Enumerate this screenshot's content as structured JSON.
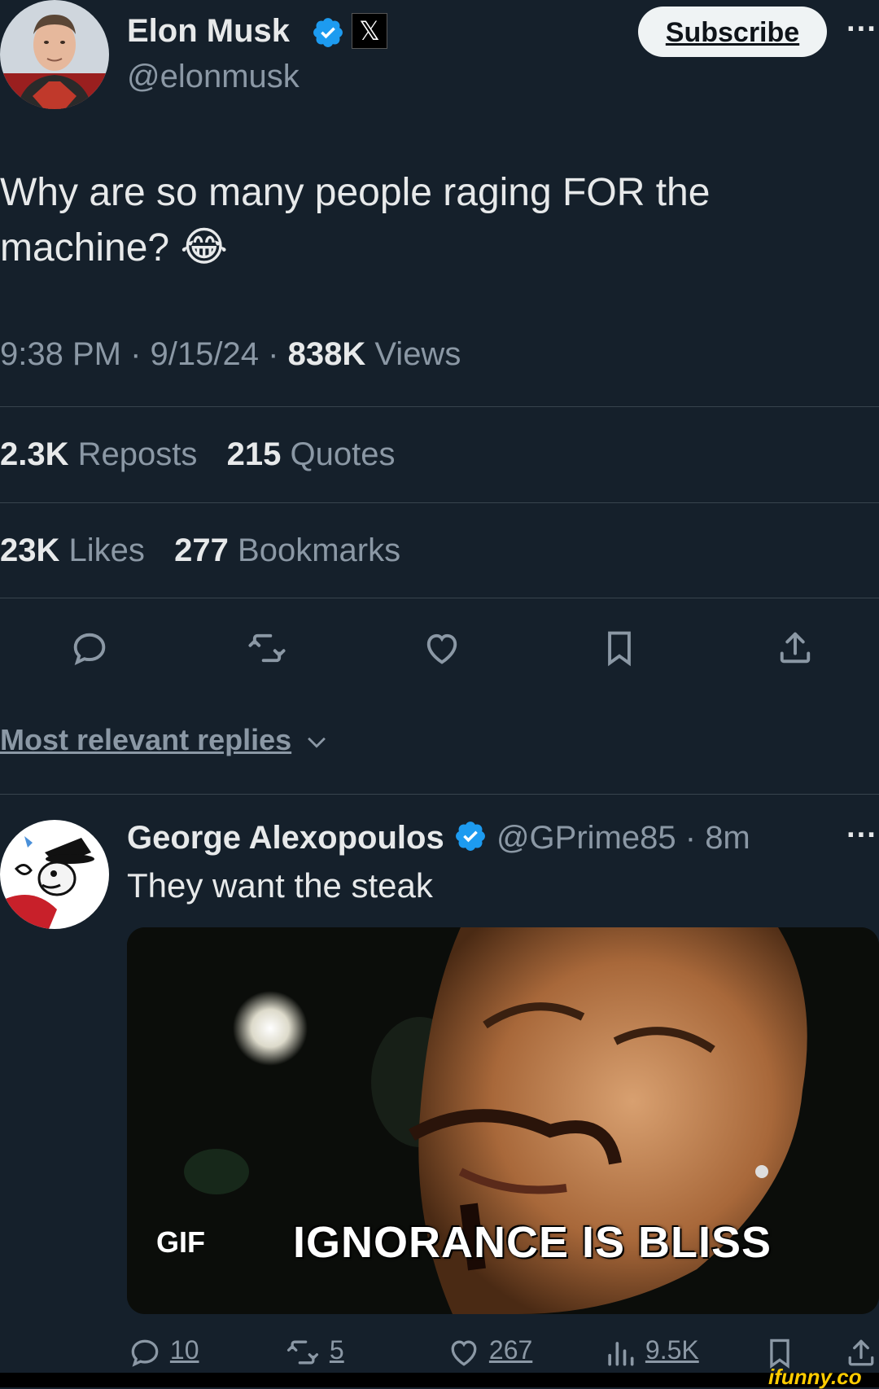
{
  "tweet": {
    "author_name": "Elon Musk",
    "author_handle": "@elonmusk",
    "text_line1": "Why are so many people raging FOR the",
    "text_line2": "machine?",
    "emoji": "😂",
    "time": "9:38 PM",
    "date": "9/15/24",
    "views_count": "838K",
    "views_label": "Views",
    "subscribe_label": "Subscribe",
    "more_label": "···",
    "x_badge": "𝕏"
  },
  "stats": {
    "reposts_count": "2.3K",
    "reposts_label": "Reposts",
    "quotes_count": "215",
    "quotes_label": "Quotes",
    "likes_count": "23K",
    "likes_label": "Likes",
    "bookmarks_count": "277",
    "bookmarks_label": "Bookmarks"
  },
  "replies_filter": {
    "label": "Most relevant replies"
  },
  "reply": {
    "author_name": "George Alexopoulos",
    "author_handle": "@GPrime85",
    "time": "8m",
    "text": "They want the steak",
    "gif_badge": "GIF",
    "gif_caption": "IGNORANCE IS BLISS",
    "replies_count": "10",
    "reposts_count": "5",
    "likes_count": "267",
    "views_count": "9.5K",
    "more_label": "···"
  },
  "watermark": "ifunny.co",
  "colors": {
    "background": "#15202b",
    "text": "#e7e9ea",
    "muted": "#8b98a5",
    "verified": "#1d9bf0",
    "divider": "#38444d"
  }
}
